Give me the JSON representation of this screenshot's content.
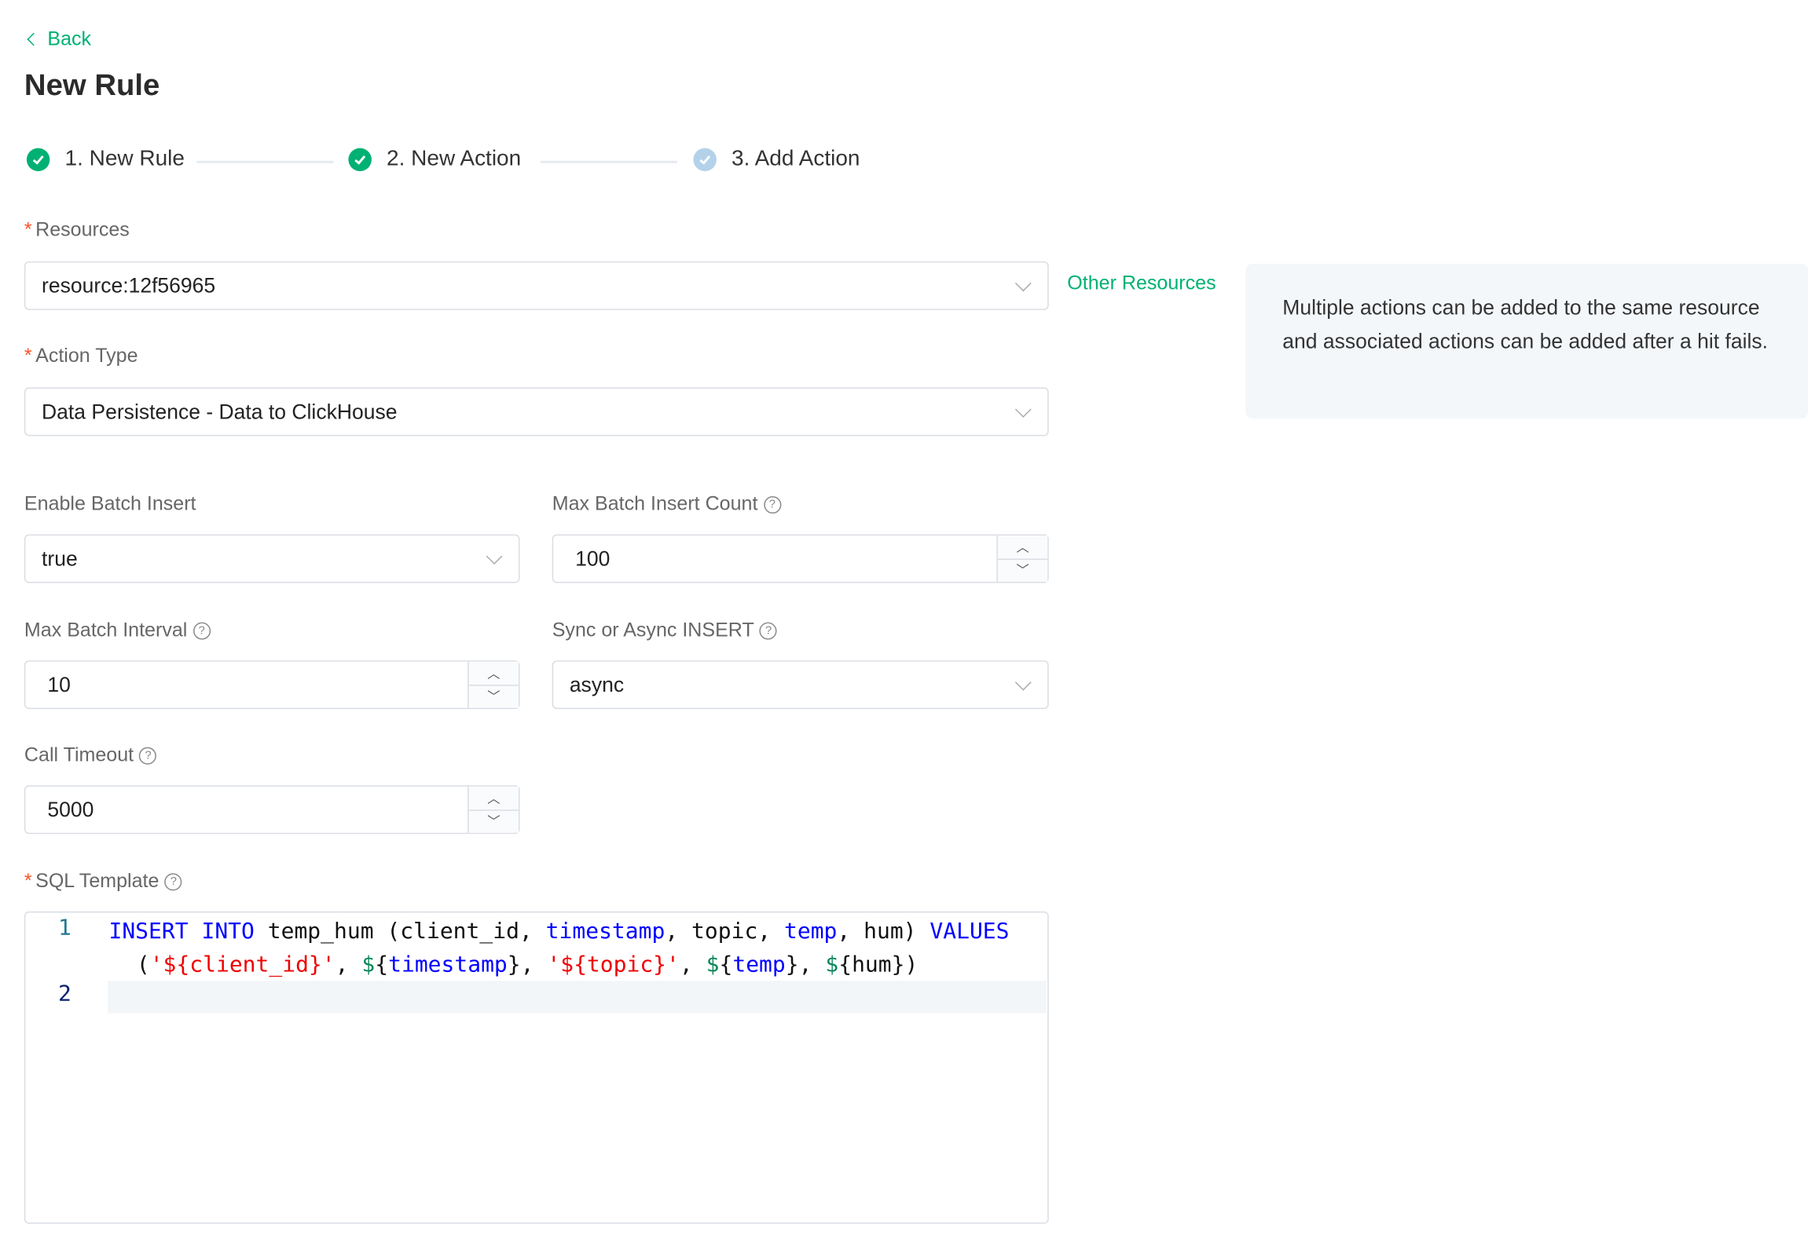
{
  "nav": {
    "back_label": "Back"
  },
  "page_title": "New Rule",
  "steps": [
    {
      "label": "1. New Rule",
      "status": "finished"
    },
    {
      "label": "2. New Action",
      "status": "finished"
    },
    {
      "label": "3. Add Action",
      "status": "current"
    }
  ],
  "colors": {
    "accent": "#00b173",
    "step_pending": "#b3d2ea",
    "required": "#f5562a",
    "sql_keyword": "#0000ff",
    "sql_string": "#ee0000",
    "sql_dollar": "#098658"
  },
  "form": {
    "resources": {
      "label": "Resources",
      "value": "resource:12f56965",
      "other_link": "Other Resources"
    },
    "action_type": {
      "label": "Action Type",
      "value": "Data Persistence - Data to ClickHouse"
    },
    "enable_batch_insert": {
      "label": "Enable Batch Insert",
      "value": "true"
    },
    "max_batch_insert_count": {
      "label": "Max Batch Insert Count",
      "value": "100"
    },
    "max_batch_interval": {
      "label": "Max Batch Interval",
      "value": "10"
    },
    "sync_async_insert": {
      "label": "Sync or Async INSERT",
      "value": "async"
    },
    "call_timeout": {
      "label": "Call Timeout",
      "value": "5000"
    },
    "sql_template": {
      "label": "SQL Template",
      "line_numbers": [
        "1",
        "2"
      ],
      "lines": [
        [
          {
            "t": "INSERT",
            "k": "kw"
          },
          {
            "t": " ",
            "k": "p"
          },
          {
            "t": "INTO",
            "k": "kw"
          },
          {
            "t": " temp_hum (client_id, ",
            "k": "p"
          },
          {
            "t": "timestamp",
            "k": "kw"
          },
          {
            "t": ", topic, ",
            "k": "p"
          },
          {
            "t": "temp",
            "k": "kw"
          },
          {
            "t": ", hum) ",
            "k": "p"
          },
          {
            "t": "VALUES",
            "k": "kw"
          },
          {
            "t": " (",
            "k": "p"
          },
          {
            "t": "'${client_id}'",
            "k": "str"
          },
          {
            "t": ", ",
            "k": "p"
          },
          {
            "t": "$",
            "k": "dol"
          },
          {
            "t": "{",
            "k": "p"
          },
          {
            "t": "timestamp",
            "k": "kw"
          },
          {
            "t": "}, ",
            "k": "p"
          },
          {
            "t": "'${topic}'",
            "k": "str"
          },
          {
            "t": ", ",
            "k": "p"
          },
          {
            "t": "$",
            "k": "dol"
          },
          {
            "t": "{",
            "k": "p"
          },
          {
            "t": "temp",
            "k": "kw"
          },
          {
            "t": "}, ",
            "k": "p"
          },
          {
            "t": "$",
            "k": "dol"
          },
          {
            "t": "{hum})",
            "k": "p"
          }
        ],
        []
      ]
    }
  },
  "tip": {
    "text": "Multiple actions can be added to the same resource and associated actions can be added after a hit fails."
  }
}
